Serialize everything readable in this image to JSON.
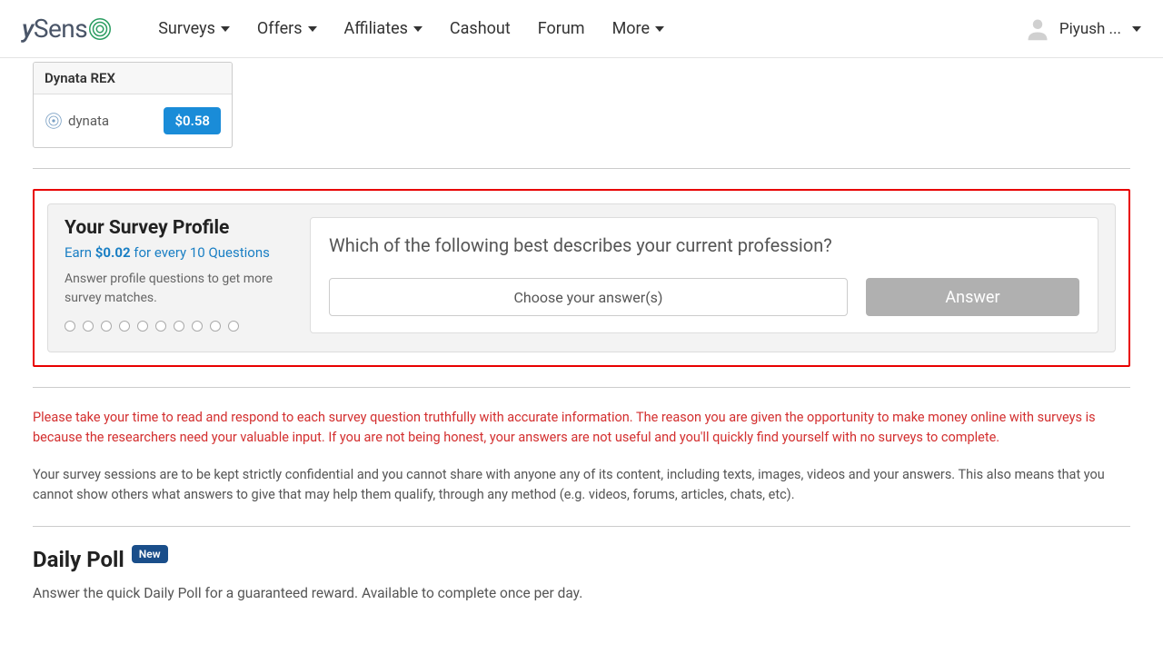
{
  "navbar": {
    "logo": "ySense",
    "links": {
      "surveys": "Surveys",
      "offers": "Offers",
      "affiliates": "Affiliates",
      "cashout": "Cashout",
      "forum": "Forum",
      "more": "More"
    },
    "username": "Piyush ..."
  },
  "surveyCard": {
    "title": "Dynata REX",
    "brand": "dynata",
    "price": "$0.58"
  },
  "profile": {
    "title": "Your Survey Profile",
    "earnPrefix": "Earn ",
    "earnAmount": "$0.02",
    "earnSuffix": " for every 10 Questions",
    "hint": "Answer profile questions to get more survey matches.",
    "question": "Which of the following best describes your current profession?",
    "selectPlaceholder": "Choose your answer(s)",
    "answerButton": "Answer"
  },
  "warning": "Please take your time to read and respond to each survey question truthfully with accurate information. The reason you are given the opportunity to make money online with surveys is because the researchers need your valuable input. If you are not being honest, your answers are not useful and you'll quickly find yourself with no surveys to complete.",
  "info": "Your survey sessions are to be kept strictly confidential and you cannot share with anyone any of its content, including texts, images, videos and your answers. This also means that you cannot show others what answers to give that may help them qualify, through any method (e.g. videos, forums, articles, chats, etc).",
  "dailyPoll": {
    "title": "Daily Poll",
    "badge": "New",
    "subtitle": "Answer the quick Daily Poll for a guaranteed reward. Available to complete once per day."
  }
}
